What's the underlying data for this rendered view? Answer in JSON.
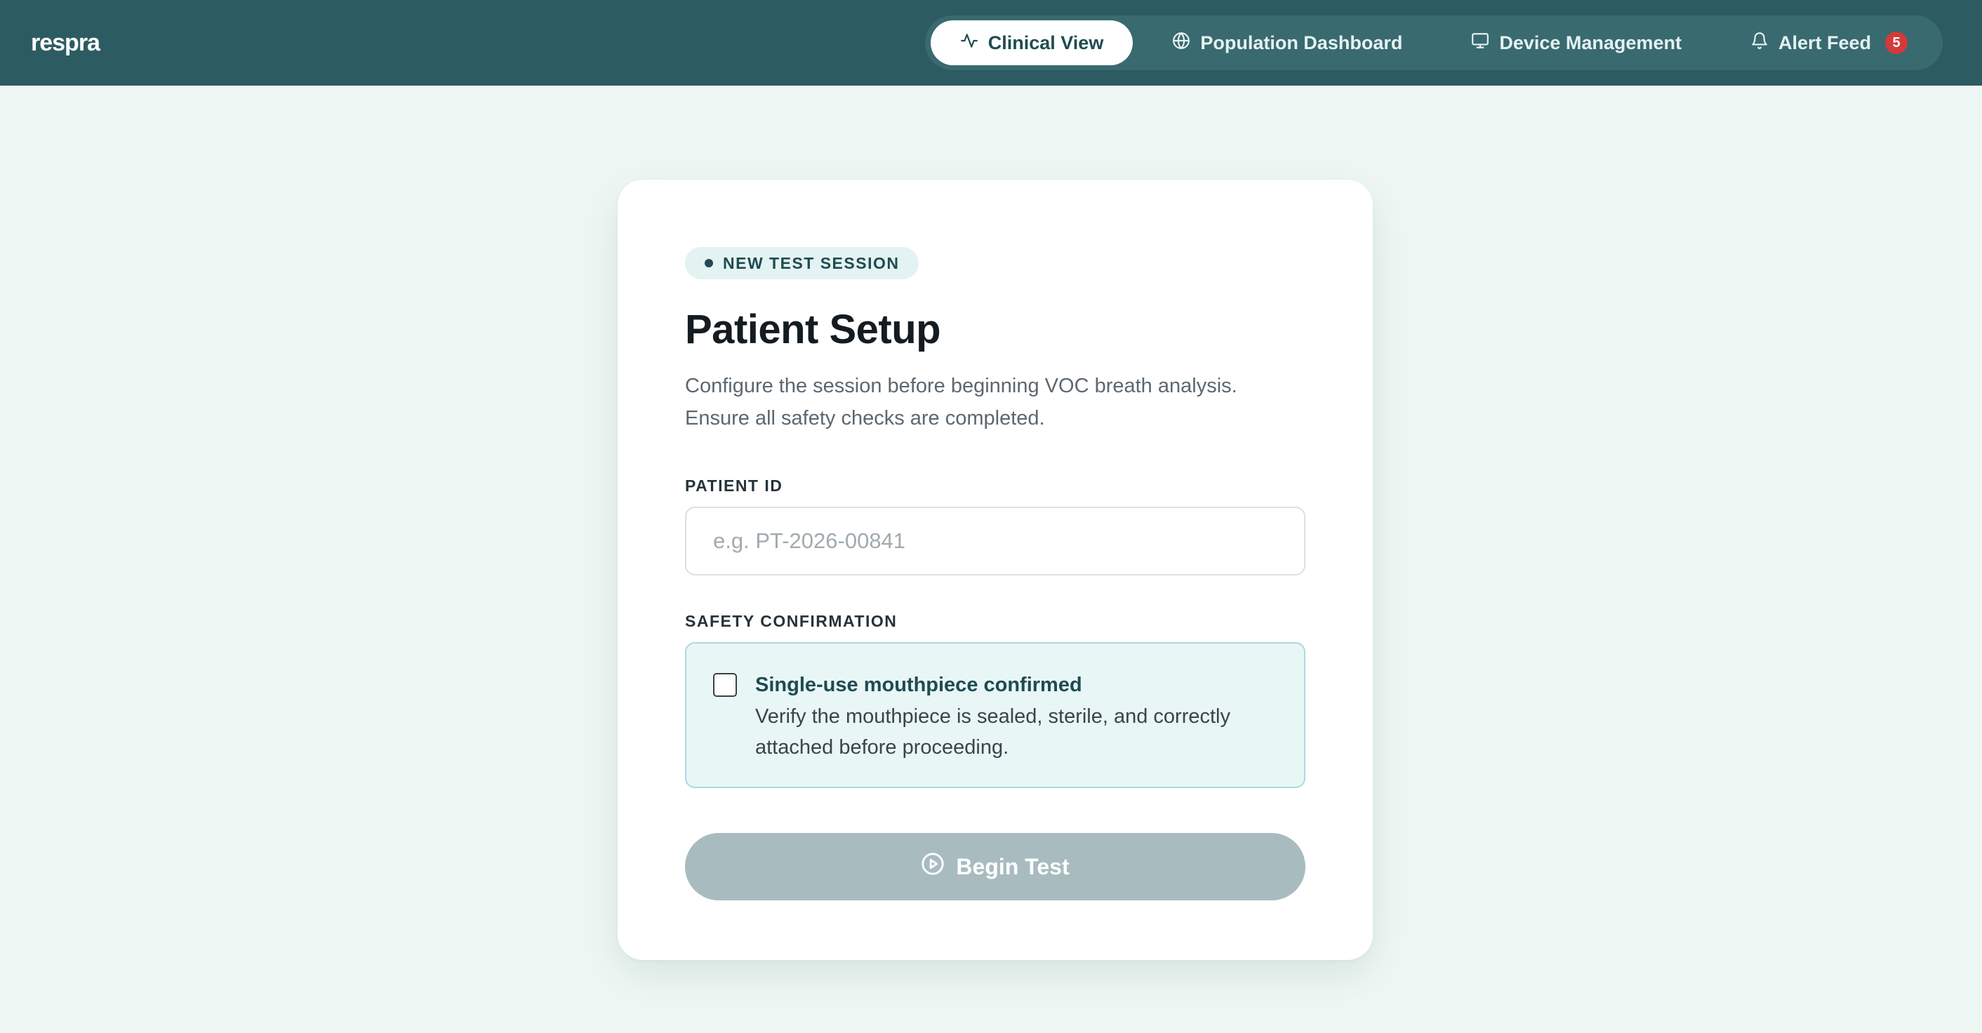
{
  "app": {
    "logo": "respra"
  },
  "nav": {
    "items": [
      {
        "label": "Clinical View",
        "icon": "activity-icon",
        "active": true
      },
      {
        "label": "Population Dashboard",
        "icon": "globe-icon",
        "active": false
      },
      {
        "label": "Device Management",
        "icon": "monitor-icon",
        "active": false
      },
      {
        "label": "Alert Feed",
        "icon": "bell-icon",
        "active": false,
        "badge": "5"
      }
    ]
  },
  "card": {
    "pill": "NEW TEST SESSION",
    "title": "Patient Setup",
    "subtitle": "Configure the session before beginning VOC breath analysis. Ensure all safety checks are completed.",
    "patient_id": {
      "label": "PATIENT ID",
      "placeholder": "e.g. PT-2026-00841",
      "value": ""
    },
    "safety": {
      "label": "SAFETY CONFIRMATION",
      "checked": false,
      "title": "Single-use mouthpiece confirmed",
      "description": "Verify the mouthpiece is sealed, sterile, and correctly attached before proceeding."
    },
    "begin_button": {
      "label": "Begin Test",
      "icon": "play-circle-icon",
      "enabled": false
    }
  },
  "colors": {
    "header_bg": "#2c5c62",
    "page_bg": "#eef7f4",
    "accent": "#1f4b52",
    "badge": "#d43a3a",
    "button_disabled": "#a8bcbf"
  }
}
